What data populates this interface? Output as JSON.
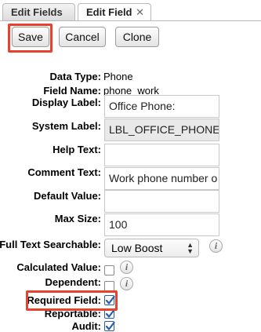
{
  "tabs": [
    {
      "label": "Edit Fields",
      "active": false
    },
    {
      "label": "Edit Field",
      "active": true,
      "close_glyph": "✕"
    }
  ],
  "toolbar": {
    "save_label": "Save",
    "cancel_label": "Cancel",
    "clone_label": "Clone"
  },
  "form": {
    "data_type": {
      "label": "Data Type:",
      "value": "Phone"
    },
    "field_name": {
      "label": "Field Name:",
      "value": "phone_work"
    },
    "display_label": {
      "label": "Display Label:",
      "value": "Office Phone:"
    },
    "system_label": {
      "label": "System Label:",
      "value": "LBL_OFFICE_PHONE"
    },
    "help_text": {
      "label": "Help Text:",
      "value": ""
    },
    "comment_text": {
      "label": "Comment Text:",
      "value": "Work phone number o"
    },
    "default_value": {
      "label": "Default Value:",
      "value": ""
    },
    "max_size": {
      "label": "Max Size:",
      "value": "100"
    },
    "full_text_searchable": {
      "label": "Full Text Searchable:",
      "value": "Low Boost"
    },
    "calculated_value": {
      "label": "Calculated Value:",
      "checked": false
    },
    "dependent": {
      "label": "Dependent:",
      "checked": false
    },
    "required_field": {
      "label": "Required Field:",
      "checked": true
    },
    "reportable": {
      "label": "Reportable:",
      "checked": true
    },
    "audit": {
      "label": "Audit:",
      "checked": true
    }
  },
  "icons": {
    "info": "i",
    "select_arrows": "▲▼"
  },
  "colors": {
    "highlight": "#e8412c",
    "checkbox_check": "#2a5db0"
  }
}
